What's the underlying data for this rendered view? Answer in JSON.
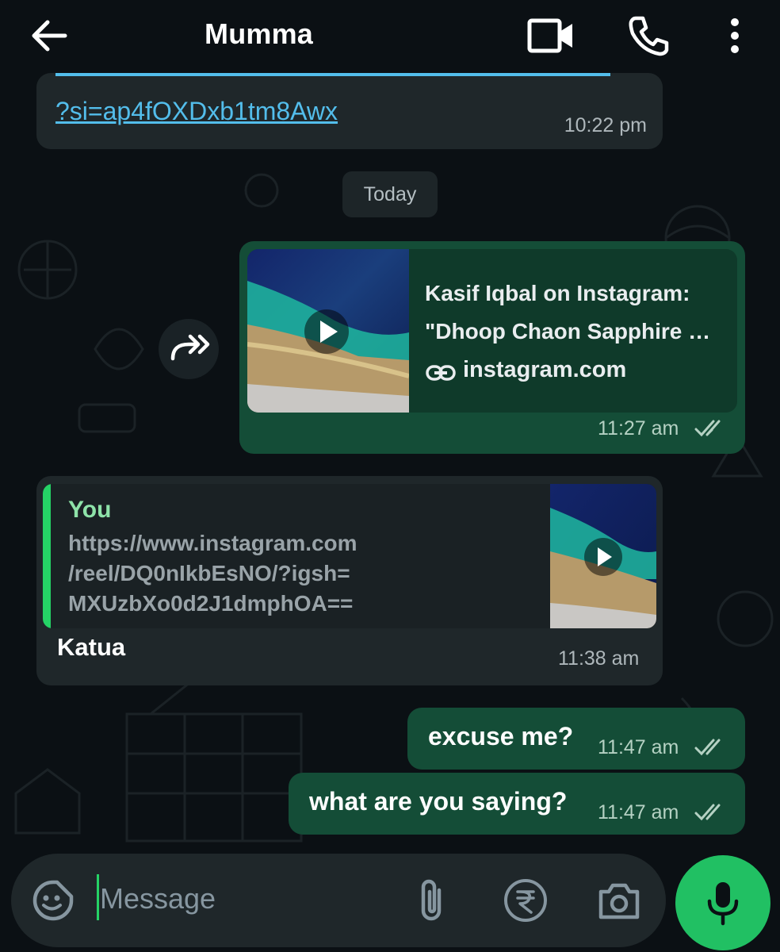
{
  "header": {
    "contact_name": "Mumma",
    "icons": [
      "back-arrow-icon",
      "video-call-icon",
      "phone-icon",
      "more-vertical-icon"
    ]
  },
  "messages": {
    "prev_link": {
      "text": "?si=ap4fOXDxb1tm8Awx",
      "time": "10:22 pm"
    },
    "date_chip": "Today",
    "link_preview": {
      "title_line1": "Kasif Iqbal on Instagram:",
      "title_line2": "\"Dhoop Chaon Sapphire …",
      "domain": "instagram.com",
      "time": "11:27 am",
      "status": "read"
    },
    "reply": {
      "quoted_sender": "You",
      "quoted_text": "https://www.instagram.com/reel/DQ0nIkbEsNO/?igsh=MXUzbXo0d2J1dmphOA==",
      "quoted_lines": [
        "https://www.instagram.com",
        "/reel/DQ0nIkbEsNO/?igsh=",
        "MXUzbXo0d2J1dmphOA=="
      ],
      "text": "Katua",
      "time": "11:38 am"
    },
    "out1": {
      "text": "excuse me?",
      "time": "11:47 am",
      "status": "read"
    },
    "out2": {
      "text": "what are you saying?",
      "time": "11:47 am",
      "status": "read"
    }
  },
  "composer": {
    "placeholder": "Message",
    "icons": [
      "sticker-icon",
      "attach-icon",
      "rupee-icon",
      "camera-icon",
      "mic-icon"
    ]
  },
  "colors": {
    "background": "#0b1014",
    "incoming_bubble": "#1f272a",
    "outgoing_bubble": "#144d37",
    "accent": "#25d366",
    "link": "#53bdeb"
  }
}
